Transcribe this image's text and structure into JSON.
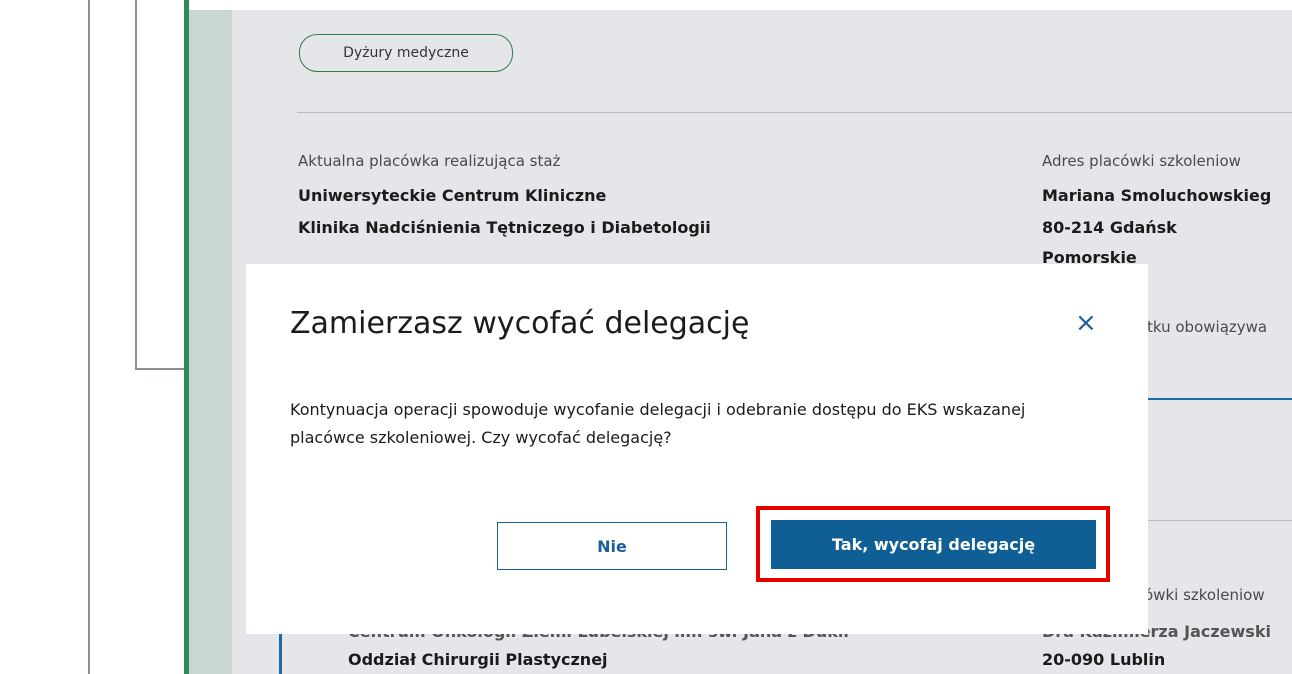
{
  "page": {
    "tag": "Dyżury medyczne",
    "current_facility": {
      "label": "Aktualna placówka realizująca staż",
      "line1": "Uniwersyteckie Centrum Kliniczne",
      "line2": "Klinika Nadciśnienia Tętniczego i Diabetologii"
    },
    "facility_address": {
      "label": "Adres placówki szkoleniow",
      "line1": "Mariana Smoluchowskieg",
      "line2": "80-214 Gdańsk",
      "line3": "Pomorskie"
    },
    "validity_label_partial": "tku obowiązywa",
    "second_address_label_partial": "ówki szkoleniow",
    "second_facility": {
      "line1": "Centrum Onkologii Ziemi Lubelskiej im. św. Jana z Dukli",
      "line2": "Oddział Chirurgii Plastycznej"
    },
    "second_address": {
      "line1": "Dra Kazimierza Jaczewski",
      "line2": "20-090 Lublin"
    }
  },
  "modal": {
    "title": "Zamierzasz wycofać delegację",
    "body": "Kontynuacja operacji spowoduje wycofanie delegacji i odebranie dostępu do EKS wskazanej placówce szkoleniowej. Czy wycofać delegację?",
    "cancel_label": "Nie",
    "confirm_label": "Tak, wycofaj delegację",
    "close_icon": "×"
  },
  "colors": {
    "accent": "#0f5e96",
    "highlight": "#e60000",
    "green": "#2e8b57"
  }
}
